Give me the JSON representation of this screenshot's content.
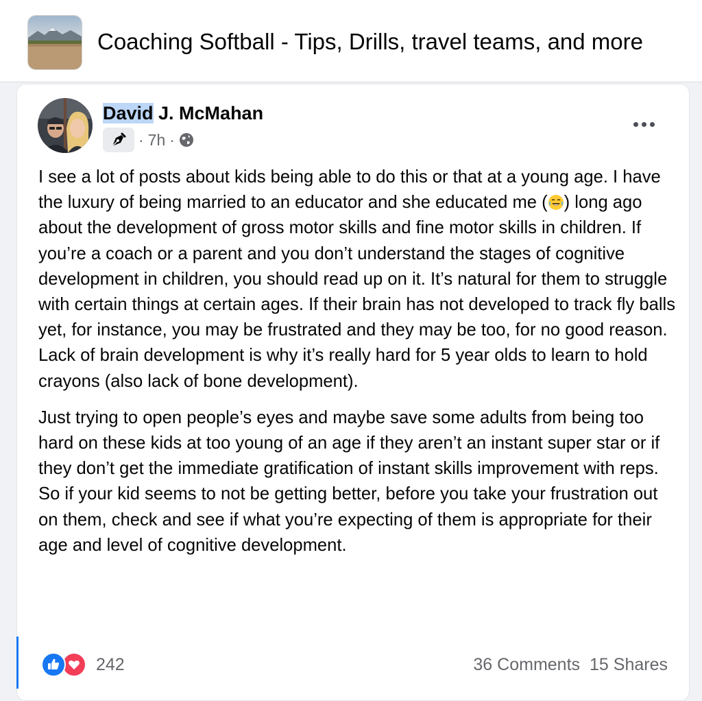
{
  "group": {
    "title": "Coaching Softball - Tips, Drills, travel teams, and more",
    "thumbnail_icon": "group-cover-image"
  },
  "post": {
    "author_first": "David",
    "author_rest": " J. McMahan",
    "author_badge_icon": "pen-nib-icon",
    "time": "7h",
    "meta_separator": "·",
    "audience_icon": "globe-icon",
    "more_icon": "more-options-icon",
    "paragraph_1_part_a": "I see a lot of posts about kids being able to do this or that at a young age. I have the luxury of being married to an educator and she educated me (",
    "paragraph_1_emoji": "tears-of-joy-emoji",
    "paragraph_1_part_b": ") long ago about the development of gross motor skills and fine motor skills in children. If you’re a coach or a parent and you don’t understand the stages of cognitive development in children, you should read up on it. It’s natural for them to struggle with certain things at certain ages. If their brain has not developed to track fly balls yet, for instance, you may be frustrated and they may be too, for no good reason. Lack of brain development is why it’s really hard for 5 year olds to learn to hold crayons (also lack of bone development).",
    "paragraph_2": "Just trying to open people’s eyes and maybe save some adults from being too hard on these kids at too young of an age if they aren’t an instant super star or if they don’t get the immediate gratification of instant skills improvement with reps. So if your kid seems to not be getting better, before you take your frustration out on them, check and see if what you’re expecting of them is appropriate for their age and level of cognitive development."
  },
  "engagement": {
    "reaction_icons": [
      "like-icon",
      "love-icon"
    ],
    "reaction_count": "242",
    "comments": "36 Comments",
    "shares": "15 Shares"
  },
  "colors": {
    "accent": "#1877f2",
    "love": "#f33e58",
    "secondary_text": "#65676b",
    "highlight": "#bcd6f7"
  }
}
